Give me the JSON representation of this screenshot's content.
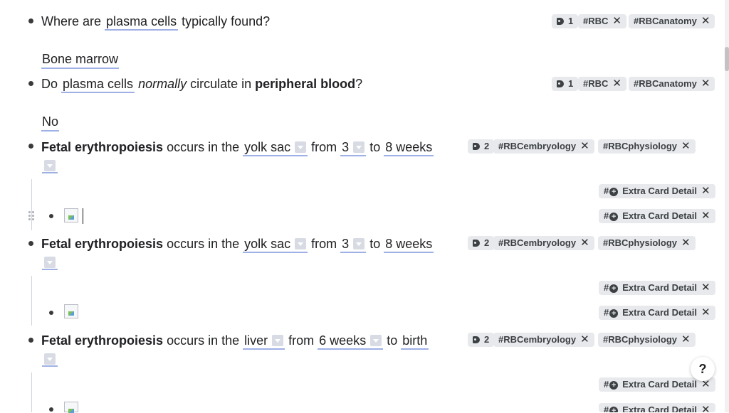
{
  "cards": [
    {
      "question_prefix": "Where are ",
      "cloze": "plasma cells",
      "question_suffix": " typically found?",
      "answer": "Bone marrow",
      "tag_count": "1",
      "tags": [
        "#RBC",
        "#RBCanatomy"
      ]
    },
    {
      "question_prefix": "Do ",
      "cloze": "plasma cells",
      "middle1": "normally",
      "middle2": " circulate in ",
      "bold": "peripheral blood",
      "question_suffix": "?",
      "answer": "No",
      "tag_count": "1",
      "tags": [
        "#RBC",
        "#RBCanatomy"
      ]
    },
    {
      "bold": "Fetal erythropoiesis",
      "text1": " occurs in the ",
      "cloze1": "yolk sac",
      "text2": " from ",
      "cloze2": "3",
      "text3": " to ",
      "cloze3": "8 weeks",
      "tag_count": "2",
      "tags": [
        "#RBCembryology",
        "#RBCphysiology"
      ]
    },
    {
      "bold": "Fetal erythropoiesis",
      "text1": " occurs in the ",
      "cloze1": "yolk sac",
      "text2": " from ",
      "cloze2": "3",
      "text3": " to ",
      "cloze3": "8 weeks",
      "tag_count": "2",
      "tags": [
        "#RBCembryology",
        "#RBCphysiology"
      ]
    },
    {
      "bold": "Fetal erythropoiesis",
      "text1": " occurs in the ",
      "cloze1": "liver",
      "text2": " from ",
      "cloze2": "6 weeks",
      "text3": " to ",
      "cloze3": "birth",
      "tag_count": "2",
      "tags": [
        "#RBCembryology",
        "#RBCphysiology"
      ]
    }
  ],
  "extra_tag": {
    "prefix": "#",
    "label": "Extra Card Detail"
  },
  "remove_glyph": "✕",
  "help_label": "?",
  "colors": {
    "cloze_underline": "#9fb0e6",
    "tag_bg": "#e8e9ec"
  }
}
